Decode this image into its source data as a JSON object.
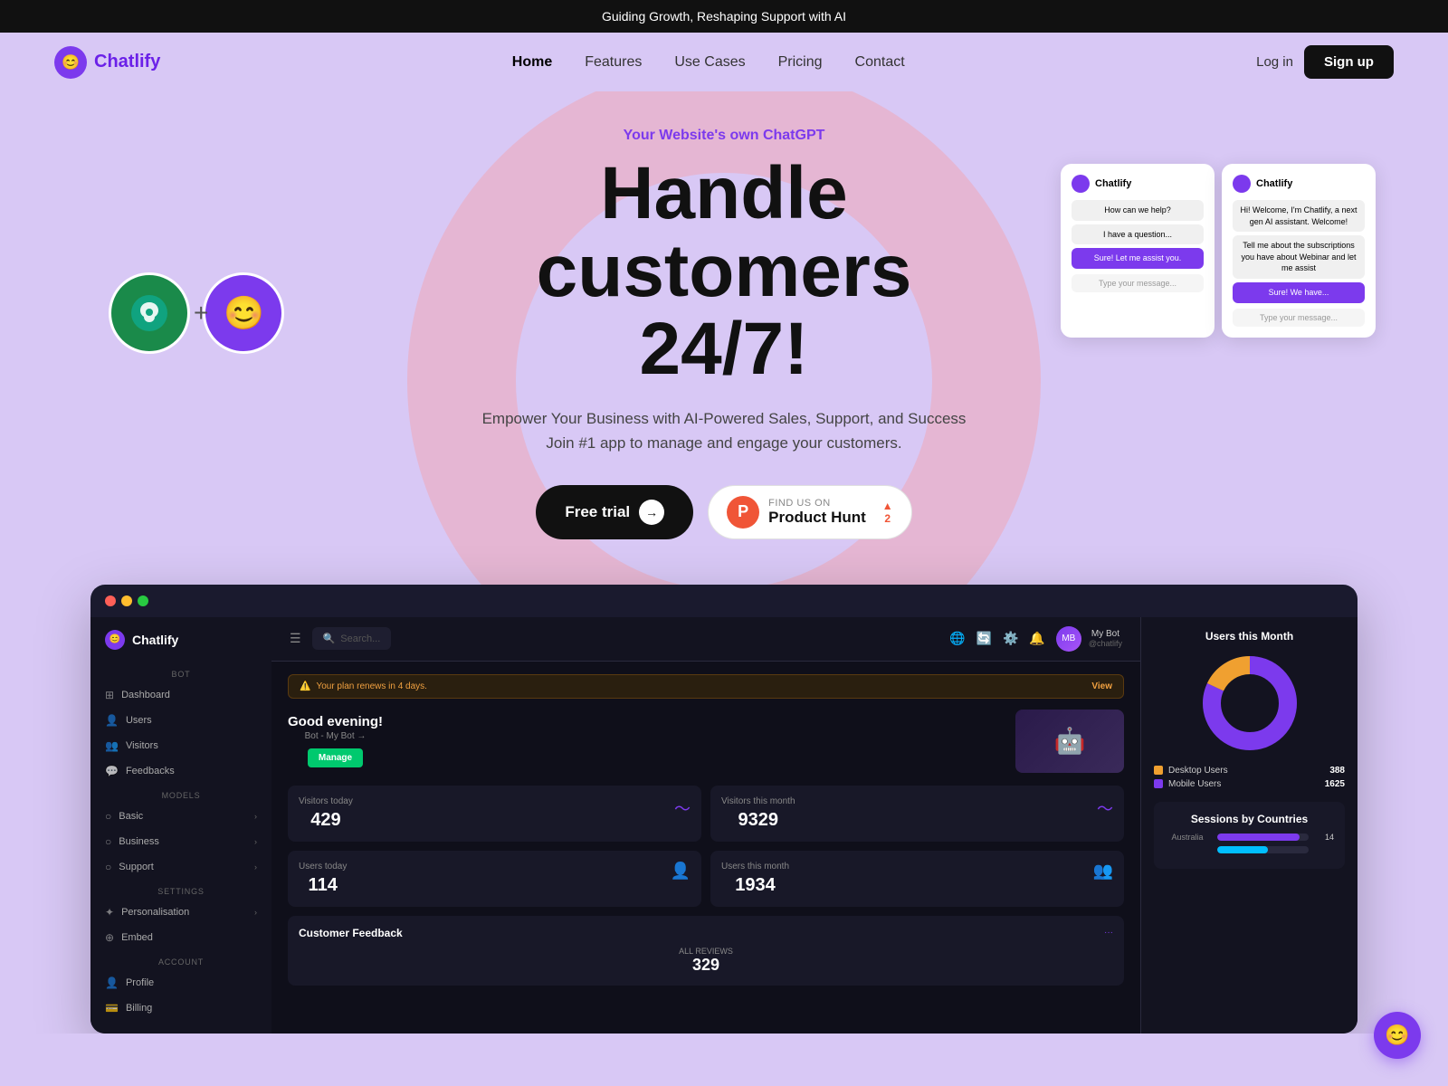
{
  "topBanner": {
    "text": "Guiding Growth, Reshaping Support with AI"
  },
  "nav": {
    "logo": "Chatlify",
    "links": [
      {
        "label": "Home",
        "active": true
      },
      {
        "label": "Features",
        "active": false
      },
      {
        "label": "Use Cases",
        "active": false
      },
      {
        "label": "Pricing",
        "active": false
      },
      {
        "label": "Contact",
        "active": false
      }
    ],
    "loginLabel": "Log in",
    "signupLabel": "Sign up"
  },
  "hero": {
    "subtitle": "Your Website's own ChatGPT",
    "title": "Handle customers 24/7!",
    "desc1": "Empower Your Business with AI-Powered Sales, Support, and Success",
    "desc2": "Join #1 app to manage and engage your customers.",
    "freeTrialLabel": "Free trial",
    "productHuntFindLabel": "FIND US ON",
    "productHuntLabel": "Product Hunt",
    "productHuntVotes": "▲ 2"
  },
  "dashboard": {
    "windowDots": [
      "red",
      "yellow",
      "green"
    ],
    "topbar": {
      "searchPlaceholder": "Search...",
      "icons": [
        "🌐",
        "🔄",
        "⚙️",
        "🔔"
      ],
      "userName": "My Bot",
      "userHandle": "@chatlify"
    },
    "sidebar": {
      "logo": "Chatlify",
      "sections": [
        {
          "label": "BOT",
          "items": [
            {
              "icon": "⊞",
              "label": "Dashboard"
            },
            {
              "icon": "👤",
              "label": "Users"
            },
            {
              "icon": "👥",
              "label": "Visitors"
            },
            {
              "icon": "💬",
              "label": "Feedbacks"
            }
          ]
        },
        {
          "label": "MODELS",
          "items": [
            {
              "icon": "○",
              "label": "Basic",
              "arrow": true
            },
            {
              "icon": "○",
              "label": "Business",
              "arrow": true
            },
            {
              "icon": "○",
              "label": "Support",
              "arrow": true
            }
          ]
        },
        {
          "label": "SETTINGS",
          "items": [
            {
              "icon": "✦",
              "label": "Personalisation",
              "arrow": true
            },
            {
              "icon": "⊕",
              "label": "Embed"
            }
          ]
        },
        {
          "label": "ACCOUNT",
          "items": [
            {
              "icon": "👤",
              "label": "Profile"
            },
            {
              "icon": "💳",
              "label": "Billing"
            }
          ]
        }
      ]
    },
    "alert": {
      "text": "Your plan renews in 4 days.",
      "viewLabel": "View"
    },
    "greeting": {
      "title": "Good evening!",
      "subtitle": "Bot - My Bot →",
      "manageLabel": "Manage"
    },
    "stats": [
      {
        "label": "Visitors today",
        "value": "429"
      },
      {
        "label": "Visitors this month",
        "value": "9329"
      },
      {
        "label": "Users today",
        "value": "114"
      },
      {
        "label": "Users this month",
        "value": "1934"
      }
    ],
    "feedback": {
      "title": "Customer Feedback",
      "reviewsLabel": "ALL REVIEWS",
      "reviewsCount": "329"
    },
    "rightPanel": {
      "title": "Users this Month",
      "donut": {
        "desktopLabel": "Desktop Users",
        "mobileLabel": "Mobile Users",
        "desktopValue": "388",
        "mobileValue": "1625",
        "desktopColor": "#f0a030",
        "mobileColor": "#7c3aed"
      },
      "sessions": {
        "title": "Sessions by Countries",
        "bars": [
          {
            "label": "Australia",
            "value": 14,
            "percent": 90,
            "color": "#7c3aed"
          },
          {
            "label": "",
            "value": "",
            "percent": 55,
            "color": "#00bfff"
          }
        ]
      }
    }
  },
  "chatWidget": {
    "icon": "💬"
  }
}
